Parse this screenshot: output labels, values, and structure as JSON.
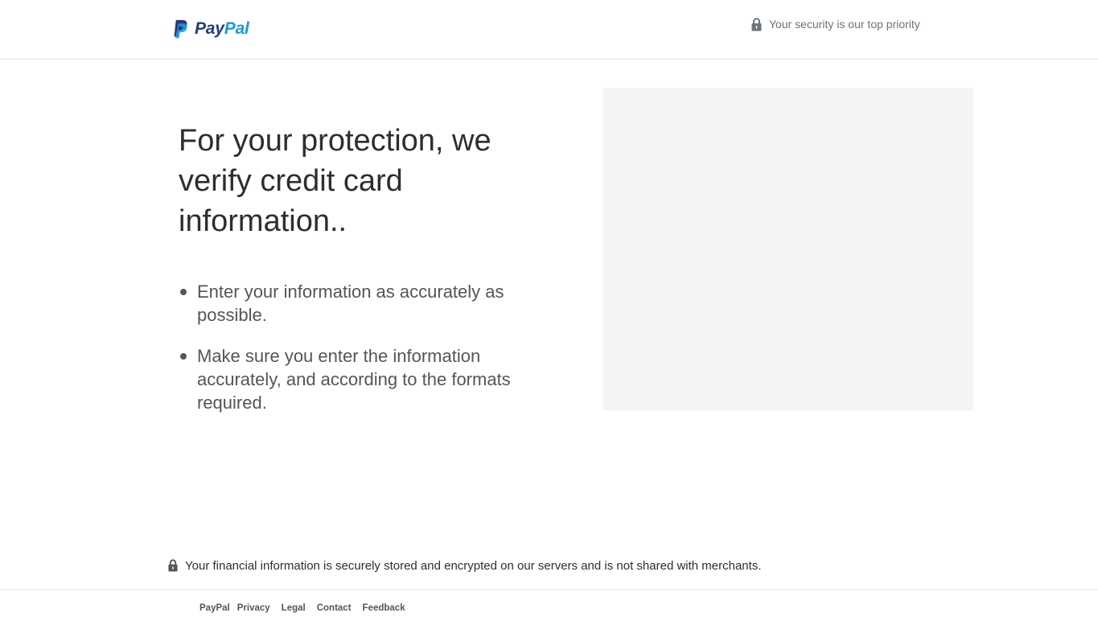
{
  "header": {
    "logo_pay": "Pay",
    "logo_pal": "Pal",
    "logo_icon": "paypal-mark-icon",
    "security_icon": "lock-icon",
    "security_text": "Your security is our top priority"
  },
  "main": {
    "headline": "For your protection, we verify credit card information..",
    "tips": [
      "Enter your information as accurately as possible.",
      "Make sure you enter the information accurately, and according to the formats required."
    ]
  },
  "footer_note": {
    "icon": "lock-icon",
    "text": "Your financial information is securely stored and encrypted on our servers and is not shared with merchants."
  },
  "footer": {
    "brand": "PayPal",
    "links": [
      "Privacy",
      "Legal",
      "Contact",
      "Feedback"
    ]
  },
  "colors": {
    "paypal_navy": "#253b80",
    "paypal_blue": "#179bd7",
    "text_dark": "#2c2e2f",
    "text_muted": "#6c7378",
    "panel_bg": "#f4f4f4"
  }
}
